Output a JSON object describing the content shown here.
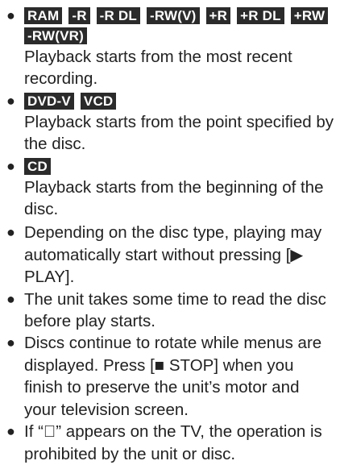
{
  "sections": [
    {
      "badges": [
        "RAM",
        "-R",
        "-R DL",
        "-RW(V)",
        "+R",
        "+R DL",
        "+RW",
        "-RW(VR)"
      ],
      "text": "Playback starts from the most recent recording."
    },
    {
      "badges": [
        "DVD-V",
        "VCD"
      ],
      "text": "Playback starts from the point specified by the disc."
    },
    {
      "badges": [
        "CD"
      ],
      "text": "Playback starts from the beginning of the disc."
    }
  ],
  "notes": [
    "Depending on the disc type, playing may automatically start without pressing [▶ PLAY].",
    "The unit takes some time to read the disc before play starts.",
    "Discs continue to rotate while menus are displayed. Press [■ STOP] when you finish to preserve the unit’s motor and your television screen.",
    "If “⃠” appears on the TV, the operation is prohibited by the unit or disc."
  ],
  "colors": {
    "badge_bg": "#2b2b2b",
    "badge_text": "#ffffff",
    "text": "#222222"
  }
}
